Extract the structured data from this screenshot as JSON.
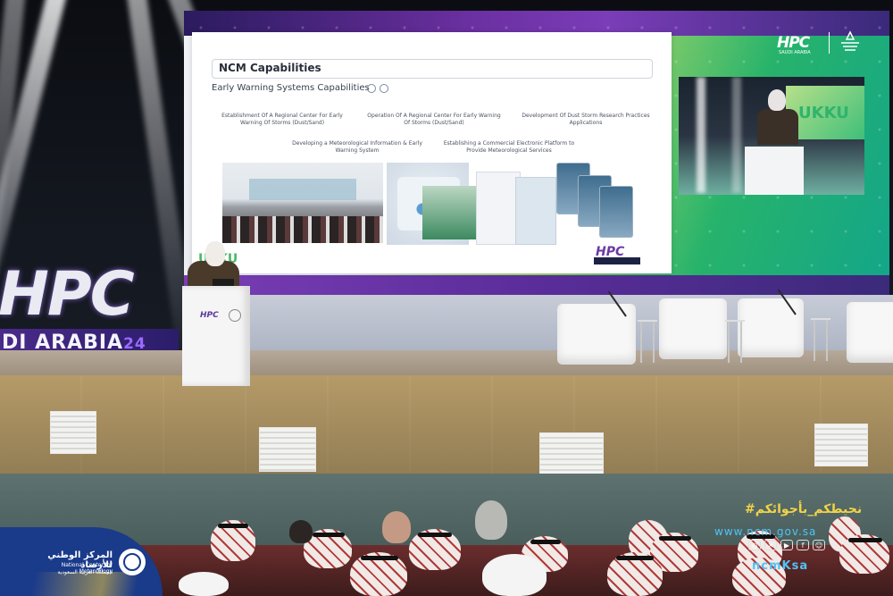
{
  "slide": {
    "title": "NCM Capabilities",
    "subtitle": "Early Warning Systems Capabilities",
    "capabilities": [
      "Establishment Of A Regional Center For Early Warning Of Storms (Dust/Sand)",
      "Operation Of A Regional Center For Early Warning Of Storms (Dust/Sand)",
      "Development Of Dust Storm Research Practices Applications",
      "Developing a Meteorological Information & Early Warning System",
      "Establishing a Commercial Electronic Platform to Provide Meteorological Services"
    ],
    "hpc_logo": "HPC"
  },
  "event": {
    "brand": "HPC",
    "brand_sub": "SAUDI ARABIA",
    "sign_letters": "HPC",
    "sign_text": "DI ARABIA",
    "sign_year": "24",
    "backdrop_mark": "PC",
    "uk_mark": "UKKU",
    "podium_logo": "HPC"
  },
  "overlay": {
    "org_arabic": "المركز الوطني للأرصاد",
    "org_english": "National Center for Meteorology",
    "org_country_arabic": "المملكة العربية السعودية",
    "hashtag": "#نحيطكم_بأجوائكم",
    "website": "www.ncm.gov.sa",
    "social_icons": [
      "instagram-icon",
      "x-icon",
      "youtube-icon",
      "facebook-icon",
      "snapchat-icon"
    ],
    "handle": "ncmKsa"
  },
  "colors": {
    "ncm_blue": "#1a3a8a",
    "hashtag_yellow": "#f2d348",
    "link_cyan": "#4fc3f7",
    "hpc_purple": "#6a3aa0",
    "led_green": "#2fb46d"
  }
}
